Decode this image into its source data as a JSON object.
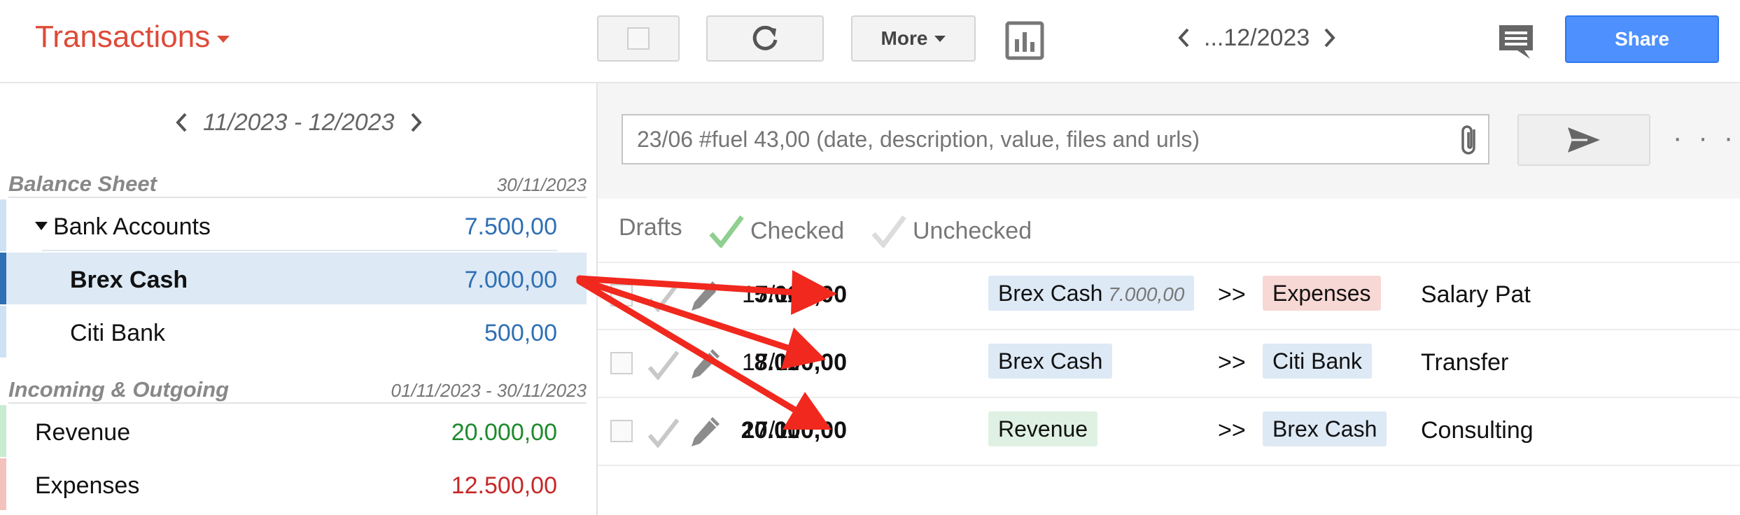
{
  "header": {
    "title": "Transactions",
    "more_label": "More",
    "period": "...12/2023",
    "share_label": "Share"
  },
  "sidebar": {
    "period": "11/2023 - 12/2023",
    "balance_sheet": {
      "title": "Balance Sheet",
      "date": "30/11/2023",
      "accounts": [
        {
          "label": "Bank Accounts",
          "value": "7.500,00"
        },
        {
          "label": "Brex Cash",
          "value": "7.000,00"
        },
        {
          "label": "Citi Bank",
          "value": "500,00"
        }
      ]
    },
    "incoming_outgoing": {
      "title": "Incoming & Outgoing",
      "date": "01/11/2023 - 30/11/2023",
      "accounts": [
        {
          "label": "Revenue",
          "value": "20.000,00"
        },
        {
          "label": "Expenses",
          "value": "12.500,00"
        }
      ]
    }
  },
  "quick_entry": {
    "placeholder": "23/06 #fuel 43,00 (date, description, value, files and urls)",
    "more_label": "· · ·"
  },
  "filters": {
    "drafts": "Drafts",
    "checked": "Checked",
    "unchecked": "Unchecked"
  },
  "transactions": [
    {
      "date": "17/11",
      "amount": "5.000,00",
      "from": "Brex Cash",
      "from_balance": "7.000,00",
      "sep": ">>",
      "to": "Expenses",
      "description": "Salary Pat"
    },
    {
      "date": "17/11",
      "amount": "8.000,00",
      "from": "Brex Cash",
      "sep": ">>",
      "to": "Citi Bank",
      "description": "Transfer"
    },
    {
      "date": "17/11",
      "amount": "20.000,00",
      "from": "Revenue",
      "sep": ">>",
      "to": "Brex Cash",
      "description": "Consulting"
    }
  ],
  "colors": {
    "title_red": "#dd4b39",
    "share_blue": "#4d90fe",
    "asset_blue": "#2f6fb4",
    "revenue_green": "#1e8a2c",
    "expense_red": "#c62828",
    "annotation_red": "#f0281e"
  }
}
